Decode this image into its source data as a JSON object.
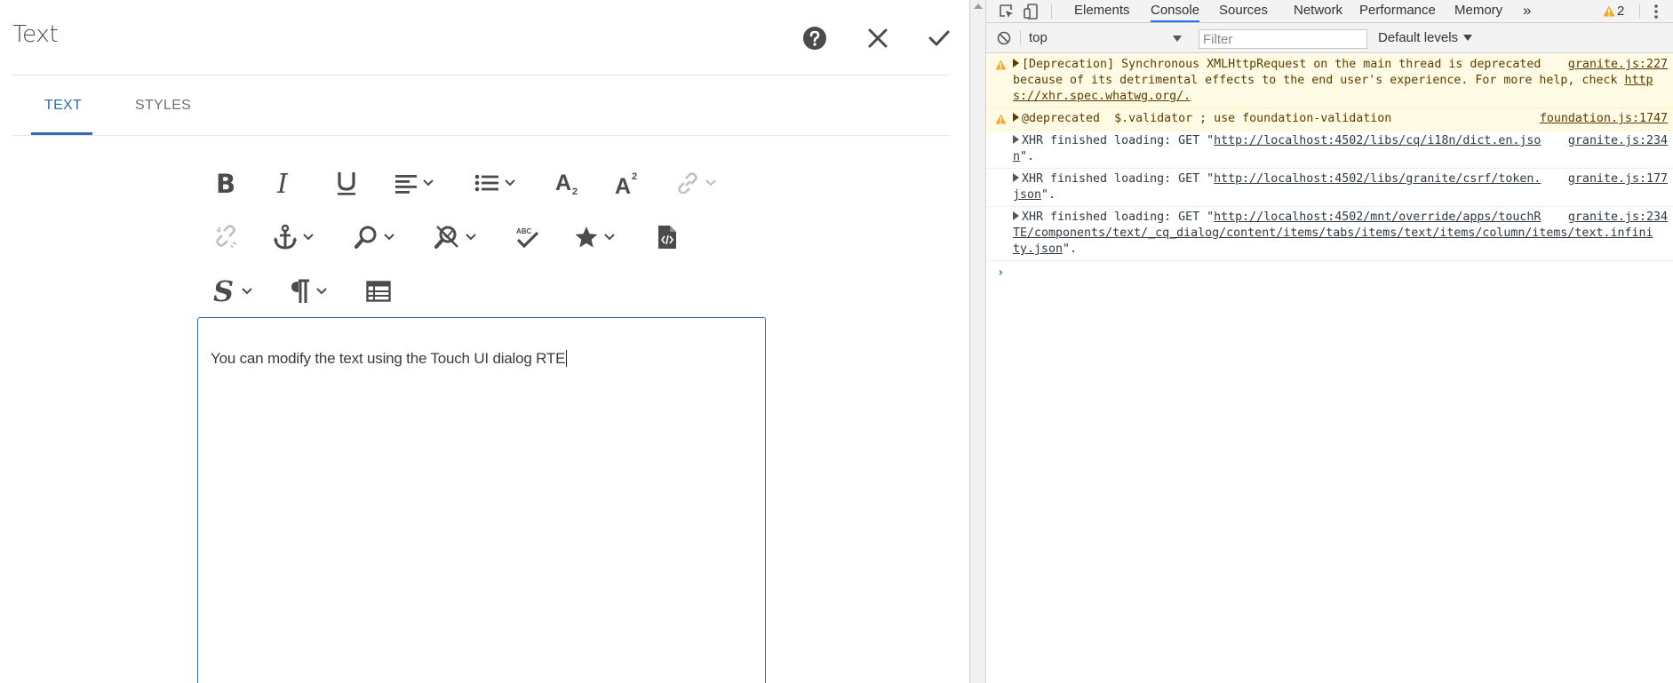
{
  "dialog": {
    "title": "Text",
    "tabs": [
      {
        "label": "TEXT",
        "active": true
      },
      {
        "label": "STYLES",
        "active": false
      }
    ],
    "toolbar_icons": [
      "bold-icon",
      "italic-icon",
      "underline-icon",
      "align-icon",
      "list-icon",
      "subscript-icon",
      "superscript-icon",
      "link-icon",
      "unlink-icon",
      "anchor-icon",
      "find-replace-icon",
      "spellcheck-toggle-icon",
      "spellcheck-icon",
      "special-char-icon",
      "source-edit-icon",
      "styles-icon",
      "paragraph-format-icon",
      "table-icon"
    ],
    "editor_text": "You can modify the text using the Touch UI dialog RTE",
    "accent_color": "#2d6ab7"
  },
  "devtools": {
    "tabs": [
      {
        "label": "Elements",
        "active": false
      },
      {
        "label": "Console",
        "active": true
      },
      {
        "label": "Sources",
        "active": false
      },
      {
        "label": "Network",
        "active": false
      },
      {
        "label": "Performance",
        "active": false
      },
      {
        "label": "Memory",
        "active": false
      }
    ],
    "more_tabs": "»",
    "warning_count": "2",
    "context": "top",
    "filter_placeholder": "Filter",
    "levels_label": "Default levels",
    "messages": [
      {
        "level": "warning",
        "lines": [
          "[Deprecation] Synchronous XMLHttpRequest on the main thread is deprecated",
          "because of its detrimental effects to the end user's experience. For more help, check ",
          "s://xhr.spec.whatwg.org/."
        ],
        "link_start": "http",
        "source": "granite.js:227"
      },
      {
        "level": "warning",
        "text": "@deprecated  $.validator ; use foundation-validation",
        "source": "foundation.js:1747"
      },
      {
        "level": "info",
        "prefix": "XHR finished loading: GET \"",
        "url_a": "http://localhost:4502/libs/cq/i18n/dict.en.jso",
        "url_b": "n",
        "suffix": "\".",
        "source": "granite.js:234"
      },
      {
        "level": "info",
        "prefix": "XHR finished loading: GET \"",
        "url_a": "http://localhost:4502/libs/granite/csrf/token.",
        "url_b": "json",
        "suffix": "\".",
        "source": "granite.js:177"
      },
      {
        "level": "info",
        "prefix": "XHR finished loading: GET \"",
        "url_a": "http://localhost:4502/mnt/override/apps/touchR",
        "url_b": "TE/components/text/_cq_dialog/content/items/tabs/items/text/items/column/items/text.infini",
        "url_c": "ty.json",
        "suffix": "\".",
        "source": "granite.js:234"
      }
    ],
    "warning_color": "#f2ab26"
  }
}
